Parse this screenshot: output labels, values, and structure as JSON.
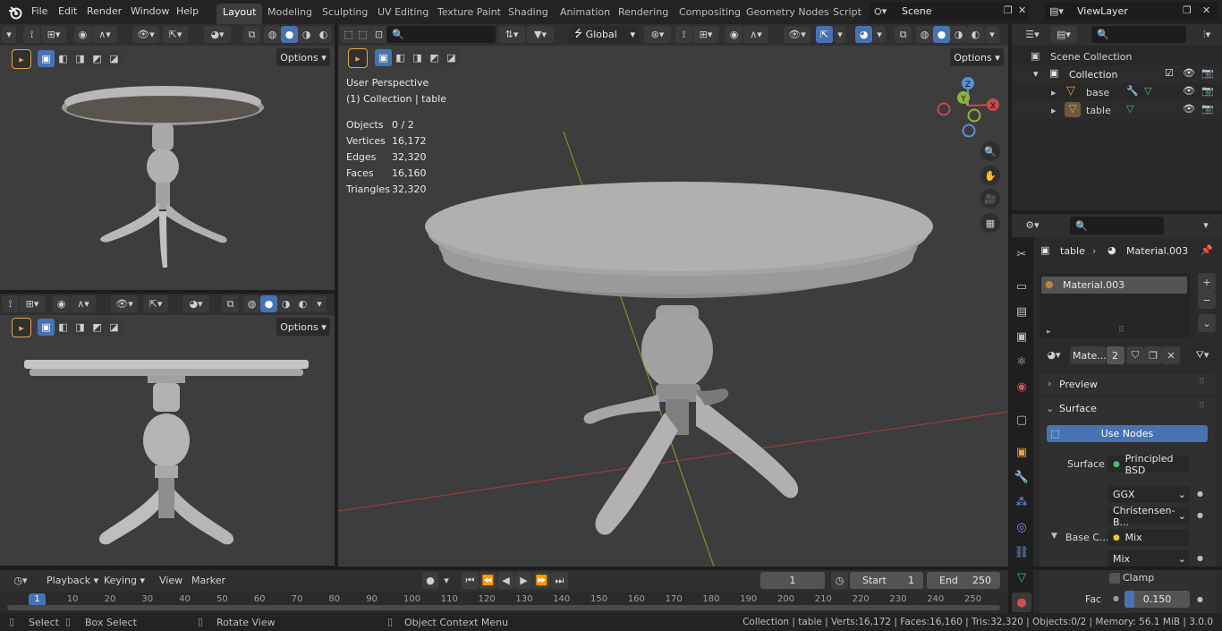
{
  "app": {
    "menu": [
      "File",
      "Edit",
      "Render",
      "Window",
      "Help"
    ],
    "workspaces": [
      "Layout",
      "Modeling",
      "Sculpting",
      "UV Editing",
      "Texture Paint",
      "Shading",
      "Animation",
      "Rendering",
      "Compositing",
      "Geometry Nodes",
      "Scripting"
    ],
    "active_workspace": "Layout",
    "scene": "Scene",
    "view_layer": "ViewLayer"
  },
  "viewport": {
    "options_label": "Options",
    "orientation": "Global",
    "perspective": "User Perspective",
    "collection_info": "(1) Collection | table",
    "stats": [
      {
        "label": "Objects",
        "value": "0 / 2"
      },
      {
        "label": "Vertices",
        "value": "16,172"
      },
      {
        "label": "Edges",
        "value": "32,320"
      },
      {
        "label": "Faces",
        "value": "16,160"
      },
      {
        "label": "Triangles",
        "value": "32,320"
      }
    ],
    "gizmo": {
      "x": "X",
      "y": "Y",
      "z": "Z"
    }
  },
  "outliner": {
    "root": "Scene Collection",
    "collection": "Collection",
    "items": [
      "base",
      "table"
    ]
  },
  "properties": {
    "breadcrumb_object": "table",
    "breadcrumb_material": "Material.003",
    "slot": "Material.003",
    "material_short": "Mate...",
    "users": "2",
    "panels": {
      "preview": "Preview",
      "surface": "Surface"
    },
    "use_nodes": "Use Nodes",
    "rows": {
      "surface_label": "Surface",
      "surface_value": "Principled BSD",
      "dist": "GGX",
      "sss": "Christensen-B...",
      "base_label": "Base C...",
      "base_value": "Mix",
      "mix_mode": "Mix",
      "clamp": "Clamp",
      "fac_label": "Fac",
      "fac_value": "0.150"
    },
    "fac": 0.15
  },
  "timeline": {
    "menus": [
      "Playback",
      "Keying",
      "View",
      "Marker"
    ],
    "current_frame": "1",
    "start_label": "Start",
    "start": "1",
    "end_label": "End",
    "end": "250",
    "ticks": [
      "1",
      "10",
      "20",
      "30",
      "40",
      "50",
      "60",
      "70",
      "80",
      "90",
      "100",
      "110",
      "120",
      "130",
      "140",
      "150",
      "160",
      "170",
      "180",
      "190",
      "200",
      "210",
      "220",
      "230",
      "240",
      "250"
    ]
  },
  "statusbar": {
    "select": "Select",
    "box_select": "Box Select",
    "rotate": "Rotate View",
    "context": "Object Context Menu",
    "info": "Collection | table | Verts:16,172 | Faces:16,160 | Tris:32,320 | Objects:0/2 | Memory: 56.1 MiB | 3.0.0"
  },
  "colors": {
    "accent": "#4772b3",
    "x_axis": "#c94a4a",
    "y_axis": "#8cb43c",
    "z_axis": "#5a8ed6",
    "node_green": "#3ec46d",
    "node_yellow": "#e8c33d"
  }
}
